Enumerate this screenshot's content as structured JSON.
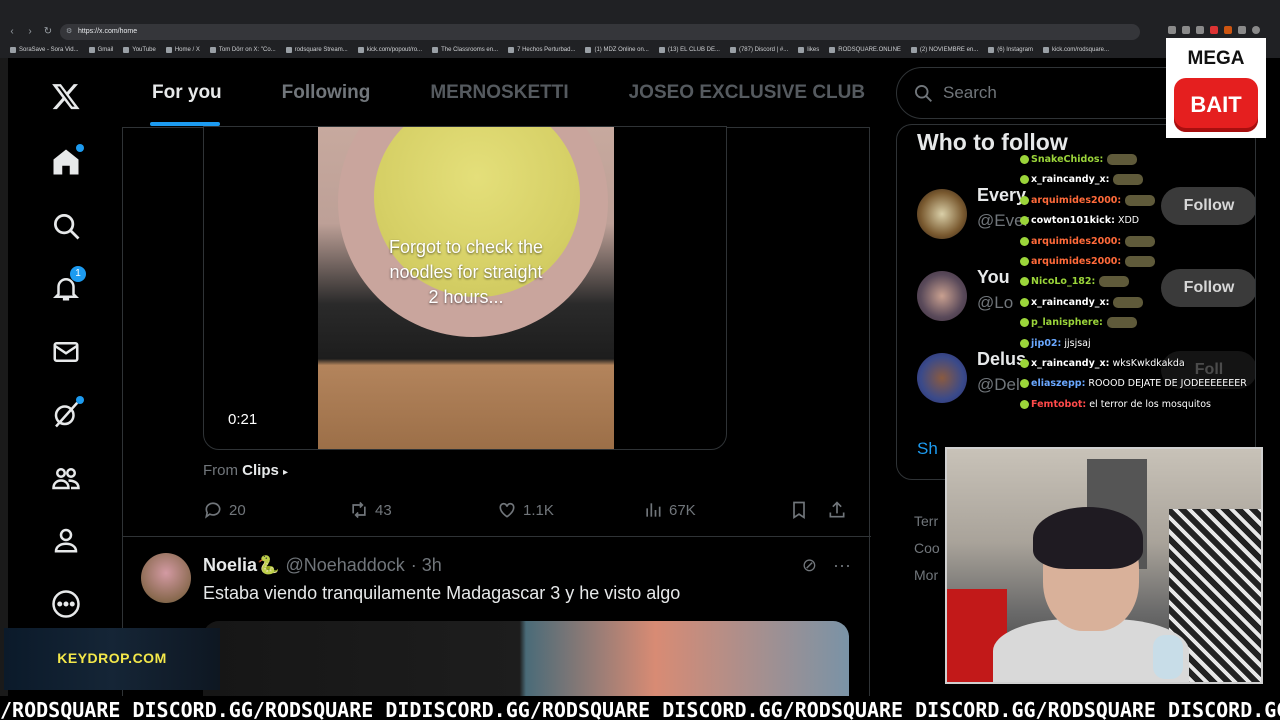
{
  "browser": {
    "url": "https://x.com/home",
    "bookmarks": [
      "SoraSave - Sora Vid...",
      "Gmail",
      "YouTube",
      "Home / X",
      "Tom Dörr on X: \"Co...",
      "rodsquare Stream...",
      "kick.com/popout/ro...",
      "The Classrooms en...",
      "7 Hechos Perturbad...",
      "(1) MDZ Online on...",
      "(13) EL CLUB DE...",
      "(787) Discord | #...",
      "likes",
      "RODSQUARE.ONLINE",
      "(2) NOVIEMBRE en...",
      "(6) Instagram",
      "kick.com/rodsquare..."
    ]
  },
  "nav": {
    "notifications_badge": "1",
    "icons": [
      "x-logo-icon",
      "home-icon",
      "search-icon",
      "bell-icon",
      "mail-icon",
      "grok-icon",
      "communities-icon",
      "profile-icon",
      "more-icon"
    ]
  },
  "tabs": [
    "For you",
    "Following",
    "MERNOSKETTI",
    "JOSEO EXCLUSIVE CLUB"
  ],
  "tweet1": {
    "caption_line1": "Forgot to check the",
    "caption_line2": "noodles for straight",
    "caption_line3": "2 hours...",
    "duration": "0:21",
    "from_prefix": "From",
    "from_source": "Clips",
    "replies": "20",
    "reposts": "43",
    "likes": "1.1K",
    "views": "67K"
  },
  "tweet2": {
    "name": "Noelia🐍",
    "handle": "@Noehaddock",
    "time": "· 3h",
    "text": "Estaba viendo tranquilamente Madagascar 3 y he visto algo"
  },
  "sidebar": {
    "search_placeholder": "Search",
    "wtf_title": "Who to follow",
    "suggestions": [
      {
        "name": "Every",
        "handle": "@Ever",
        "follow": "Follow"
      },
      {
        "name": "You",
        "handle": "@Lo",
        "follow": "Follow"
      },
      {
        "name": "Delus",
        "handle": "@Del",
        "follow": "Foll"
      }
    ],
    "show_more": "Sh",
    "footer": [
      "Terr",
      "Coo",
      "Mor"
    ]
  },
  "chat": [
    {
      "user": "SnakeChidos:",
      "color": "#9bd53a",
      "msg": ""
    },
    {
      "user": "x_raincandy_x:",
      "color": "#ffffff",
      "msg": ""
    },
    {
      "user": "arquimides2000:",
      "color": "#ff6a3a",
      "msg": ""
    },
    {
      "user": "cowton101kick:",
      "color": "#ffffff",
      "msg": "XDD"
    },
    {
      "user": "arquimides2000:",
      "color": "#ff6a3a",
      "msg": ""
    },
    {
      "user": "arquimides2000:",
      "color": "#ff6a3a",
      "msg": ""
    },
    {
      "user": "NicoLo_182:",
      "color": "#9bd53a",
      "msg": ""
    },
    {
      "user": "x_raincandy_x:",
      "color": "#ffffff",
      "msg": ""
    },
    {
      "user": "p_lanisphere:",
      "color": "#9bd53a",
      "msg": ""
    },
    {
      "user": "jip02:",
      "color": "#6aa8ff",
      "msg": "jjsjsaj"
    },
    {
      "user": "x_raincandy_x:",
      "color": "#ffffff",
      "msg": "wksKwkdkakda"
    },
    {
      "user": "eliaszepp:",
      "color": "#6aa8ff",
      "msg": "ROOOD DEJATE DE JODEEEEEEER"
    },
    {
      "user": "Femtobot:",
      "color": "#ff4a4a",
      "msg": "el terror de los mosquitos"
    }
  ],
  "overlay": {
    "mega": "MEGA",
    "bait": "BAIT",
    "keydrop": "KEYDROP.COM",
    "ticker": "/RODSQUARE DISCORD.GG/RODSQUARE DIDISCORD.GG/RODSQUARE DISCORD.GG/RODSQUARE DISCORD.GG/RODSQUARE DISCORD.GG"
  },
  "colors": {
    "accent": "#1d9bf0",
    "muted": "#71767b",
    "text": "#e7e9ea"
  }
}
